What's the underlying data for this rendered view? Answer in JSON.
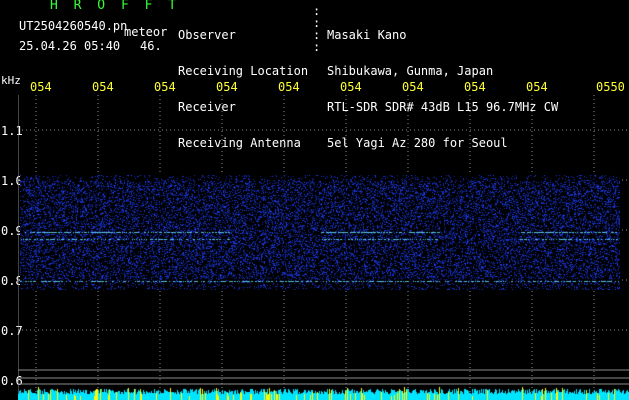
{
  "header": {
    "title": "H R O F F T",
    "filename": "UT2504260540.pn",
    "meteor_label": "meteor",
    "date_time": "25.04.26 05:40",
    "count": "46."
  },
  "info": {
    "labels": [
      "Observer",
      "Receiving Location",
      "Receiver",
      "Receiving Antenna"
    ],
    "values": [
      "Masaki Kano",
      "Shibukawa, Gunma, Japan",
      "RTL-SDR SDR# 43dB L15 96.7MHz CW",
      "5el Yagi Az 280 for Seoul"
    ]
  },
  "axis": {
    "unit": "kHz",
    "time_ticks": [
      "054",
      "054",
      "054",
      "054",
      "054",
      "054",
      "054",
      "054",
      "054",
      "0550"
    ],
    "freq_ticks": [
      "1.1",
      "1.0",
      "0.9",
      "0.8",
      "0.7",
      "0.6"
    ]
  },
  "colors": {
    "grid": "#8a8a8a",
    "header_text": "#33ff33",
    "info_text": "#ffffff",
    "tick_text": "#ffff33",
    "bottom_bar": "#00e5ff",
    "bottom_spikes": "#ffff00",
    "spectrogram_noise": "#1a3cff",
    "echo_line": "#66e0ff"
  }
}
